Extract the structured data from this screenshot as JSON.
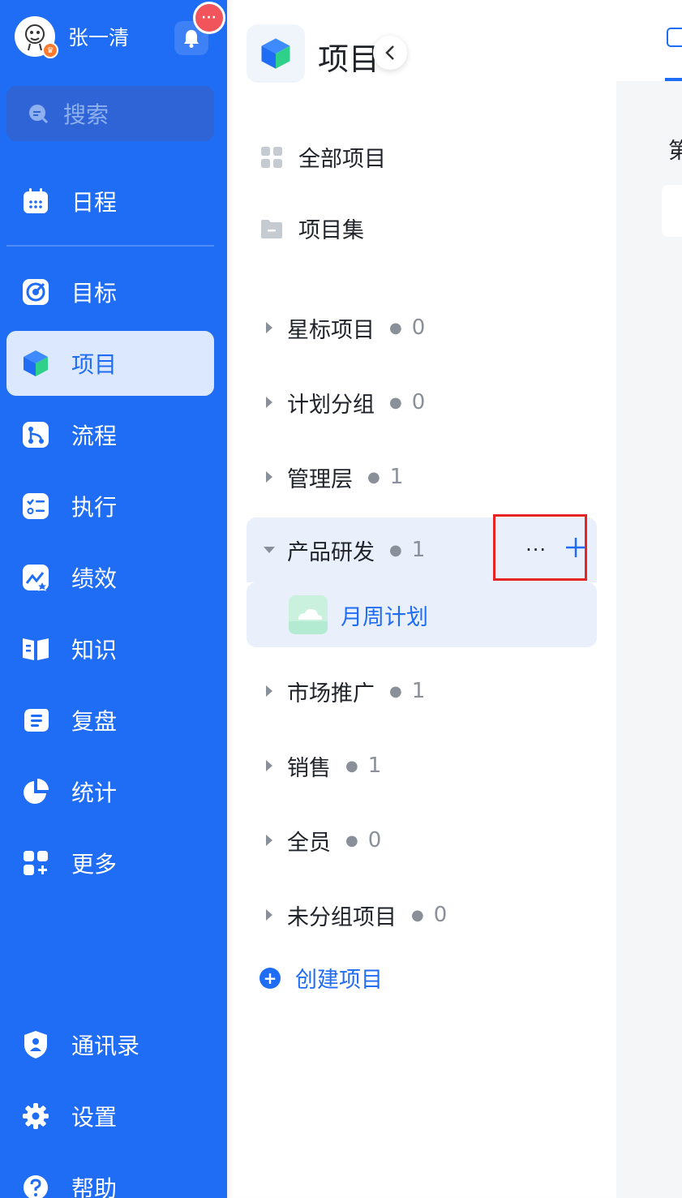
{
  "user": {
    "name": "张一清"
  },
  "search": {
    "placeholder": "搜索"
  },
  "sidebar": {
    "items": [
      {
        "label": "日程",
        "icon": "calendar-icon"
      },
      {
        "label": "目标",
        "icon": "target-icon"
      },
      {
        "label": "项目",
        "icon": "cube-icon",
        "active": true
      },
      {
        "label": "流程",
        "icon": "flow-icon"
      },
      {
        "label": "执行",
        "icon": "checklist-icon"
      },
      {
        "label": "绩效",
        "icon": "chart-star-icon"
      },
      {
        "label": "知识",
        "icon": "book-icon"
      },
      {
        "label": "复盘",
        "icon": "review-icon"
      },
      {
        "label": "统计",
        "icon": "pie-icon"
      },
      {
        "label": "更多",
        "icon": "grid-plus-icon"
      }
    ],
    "bottom": [
      {
        "label": "通讯录",
        "icon": "shield-user-icon"
      },
      {
        "label": "设置",
        "icon": "gear-icon"
      },
      {
        "label": "帮助",
        "icon": "help-icon"
      }
    ]
  },
  "panel": {
    "title": "项目",
    "links": [
      {
        "label": "全部项目",
        "icon": "grid-icon"
      },
      {
        "label": "项目集",
        "icon": "folder-icon"
      }
    ],
    "groups": [
      {
        "label": "星标项目",
        "count": "0"
      },
      {
        "label": "计划分组",
        "count": "0"
      },
      {
        "label": "管理层",
        "count": "1"
      },
      {
        "label": "产品研发",
        "count": "1",
        "expanded": true
      },
      {
        "label": "市场推广",
        "count": "1"
      },
      {
        "label": "销售",
        "count": "1"
      },
      {
        "label": "全员",
        "count": "0"
      },
      {
        "label": "未分组项目",
        "count": "0"
      }
    ],
    "child": {
      "label": "月周计划"
    },
    "more_label": "···",
    "create_label": "创建项目"
  },
  "content": {
    "partial_text": "第"
  },
  "colors": {
    "primary": "#1f6cf5",
    "highlight": "#e62424",
    "badge": "#f2545b"
  }
}
